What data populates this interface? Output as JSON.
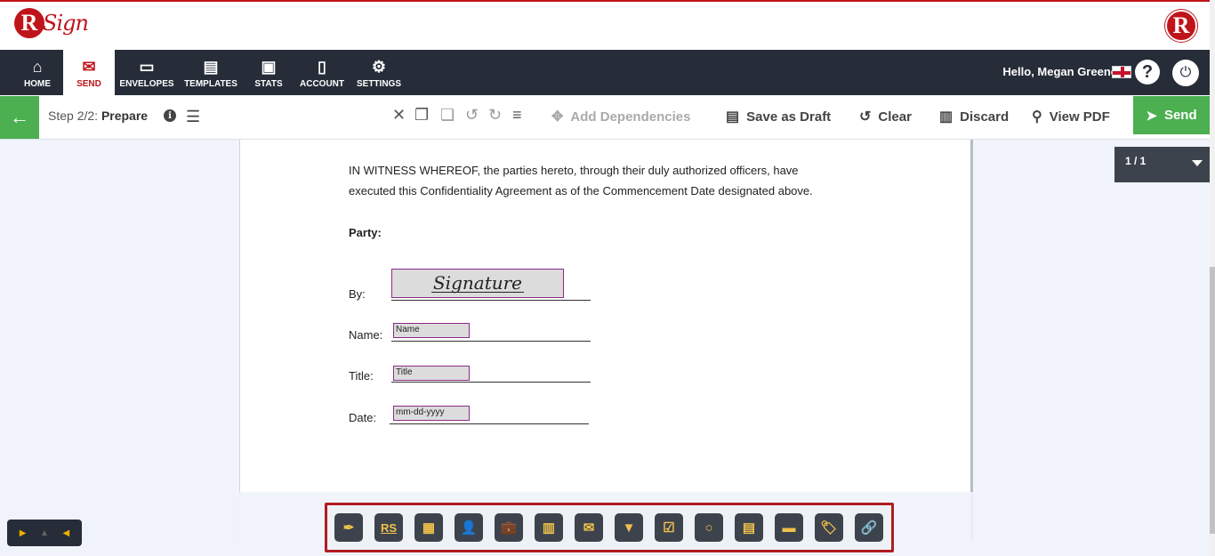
{
  "header": {
    "logo_letter": "R",
    "logo_text": "Sign",
    "logo_right_letter": "R"
  },
  "nav": {
    "items": [
      {
        "label": "HOME",
        "icon": "home-icon"
      },
      {
        "label": "SEND",
        "icon": "envelope-icon",
        "active": true
      },
      {
        "label": "ENVELOPES",
        "icon": "tray-icon"
      },
      {
        "label": "TEMPLATES",
        "icon": "templates-icon"
      },
      {
        "label": "STATS",
        "icon": "briefcase-icon"
      },
      {
        "label": "ACCOUNT",
        "icon": "account-icon"
      },
      {
        "label": "SETTINGS",
        "icon": "gear-icon"
      }
    ],
    "greeting": "Hello, Megan Greene",
    "help": "?",
    "power": "⏻"
  },
  "toolbar": {
    "step_prefix": "Step 2/2:",
    "step_name": "Prepare",
    "add_dependencies": "Add Dependencies",
    "save_as_draft": "Save as Draft",
    "clear": "Clear",
    "discard": "Discard",
    "view_pdf": "View PDF",
    "send": "Send"
  },
  "document": {
    "para_line1": "IN WITNESS WHEREOF, the parties hereto, through their duly authorized officers, have",
    "para_line2": "executed this Confidentiality Agreement as of the Commencement Date designated above.",
    "party_label": "Party:",
    "by_label": "By:",
    "signature_text": "Signature",
    "name_label": "Name:",
    "name_field": "Name",
    "title_label": "Title:",
    "title_field": "Title",
    "date_label": "Date:",
    "date_field": "mm-dd-yyyy"
  },
  "pager": {
    "page_text": "1 / 1"
  },
  "field_tools": [
    {
      "name": "signature-tool",
      "glyph": "✒"
    },
    {
      "name": "initials-tool",
      "glyph": "RS"
    },
    {
      "name": "stamp-tool",
      "glyph": "▦"
    },
    {
      "name": "name-tool",
      "glyph": "👤"
    },
    {
      "name": "title-tool",
      "glyph": "💼"
    },
    {
      "name": "company-tool",
      "glyph": "▥"
    },
    {
      "name": "email-tool",
      "glyph": "✉"
    },
    {
      "name": "dropdown-tool",
      "glyph": "▼"
    },
    {
      "name": "checkbox-tool",
      "glyph": "☑"
    },
    {
      "name": "radio-tool",
      "glyph": "○"
    },
    {
      "name": "date-tool",
      "glyph": "▤"
    },
    {
      "name": "text-tool",
      "glyph": "▬"
    },
    {
      "name": "label-tool",
      "glyph": "🏷"
    },
    {
      "name": "hyperlink-tool",
      "glyph": "🔗"
    }
  ]
}
